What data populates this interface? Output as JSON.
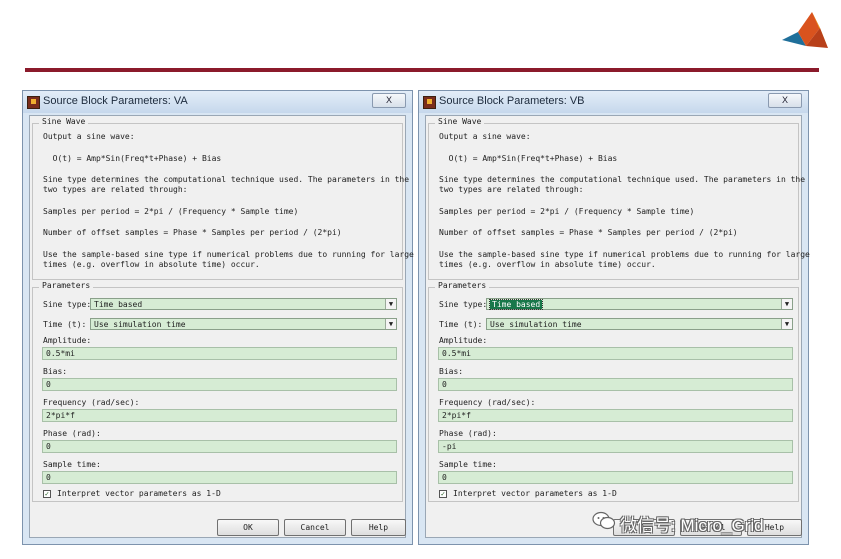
{
  "brand": {
    "logo_icon": "matlab-membrane-logo-icon",
    "divider_color": "#8b1a2b"
  },
  "dialogs": [
    {
      "title": "Source Block Parameters: VA",
      "close_label": "X",
      "sine_section": {
        "legend": "Sine Wave",
        "description": [
          "Output a sine wave:",
          "  O(t) = Amp*Sin(Freq*t+Phase) + Bias",
          "Sine type determines the computational technique used. The parameters in the",
          "two types are related through:",
          "Samples per period = 2*pi / (Frequency * Sample time)",
          "Number of offset samples = Phase * Samples per period / (2*pi)",
          "Use the sample-based sine type if numerical problems due to running for large",
          "times (e.g. overflow in absolute time) occur."
        ]
      },
      "params": {
        "legend": "Parameters",
        "sine_type_label": "Sine type:",
        "sine_type_value": "Time based",
        "time_label": "Time (t):",
        "time_value": "Use simulation time",
        "amplitude_label": "Amplitude:",
        "amplitude_value": "0.5*mi",
        "bias_label": "Bias:",
        "bias_value": "0",
        "frequency_label": "Frequency (rad/sec):",
        "frequency_value": "2*pi*f",
        "phase_label": "Phase (rad):",
        "phase_value": "0",
        "sample_time_label": "Sample time:",
        "sample_time_value": "0",
        "interpret_label": "Interpret vector parameters as 1-D",
        "interpret_checked": true
      },
      "buttons": {
        "ok": "OK",
        "cancel": "Cancel",
        "help": "Help"
      }
    },
    {
      "title": "Source Block Parameters: VB",
      "close_label": "X",
      "sine_section": {
        "legend": "Sine Wave",
        "description": [
          "Output a sine wave:",
          "  O(t) = Amp*Sin(Freq*t+Phase) + Bias",
          "Sine type determines the computational technique used. The parameters in the",
          "two types are related through:",
          "Samples per period = 2*pi / (Frequency * Sample time)",
          "Number of offset samples = Phase * Samples per period / (2*pi)",
          "Use the sample-based sine type if numerical problems due to running for large",
          "times (e.g. overflow in absolute time) occur."
        ]
      },
      "params": {
        "legend": "Parameters",
        "sine_type_label": "Sine type:",
        "sine_type_value": "Time based",
        "time_label": "Time (t):",
        "time_value": "Use simulation time",
        "amplitude_label": "Amplitude:",
        "amplitude_value": "0.5*mi",
        "bias_label": "Bias:",
        "bias_value": "0",
        "frequency_label": "Frequency (rad/sec):",
        "frequency_value": "2*pi*f",
        "phase_label": "Phase (rad):",
        "phase_value": "-pi",
        "sample_time_label": "Sample time:",
        "sample_time_value": "0",
        "interpret_label": "Interpret vector parameters as 1-D",
        "interpret_checked": true
      },
      "buttons": {
        "ok": "OK",
        "cancel": "Cancel",
        "help": "Help"
      }
    }
  ],
  "watermark": {
    "text": "微信号: Micro_Grid",
    "icon": "wechat-icon"
  }
}
